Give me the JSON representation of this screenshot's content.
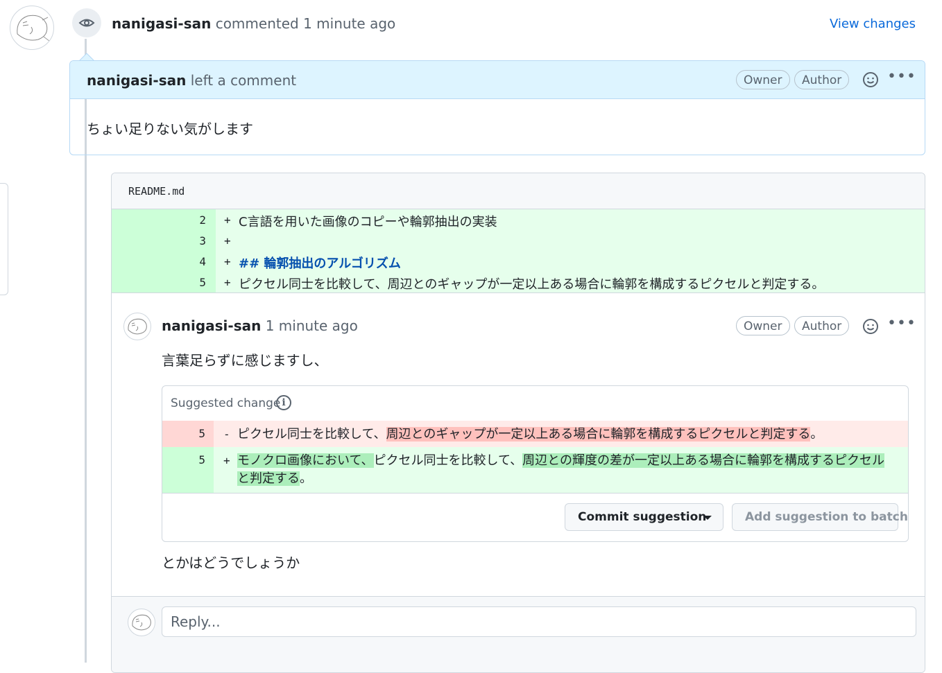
{
  "timeline": {
    "user": "nanigasi-san",
    "action": "commented",
    "time": "1 minute ago",
    "view_changes": "View changes"
  },
  "review": {
    "user": "nanigasi-san",
    "action": "left a comment",
    "badges": [
      "Owner",
      "Author"
    ],
    "body": "ちょい足りない気がします"
  },
  "file": {
    "name": "README.md",
    "lines": [
      {
        "num": "2",
        "sign": "+",
        "text": "C言語を用いた画像のコピーや輪郭抽出の実装"
      },
      {
        "num": "3",
        "sign": "+",
        "text": ""
      },
      {
        "num": "4",
        "sign": "+",
        "text": "## 輪郭抽出のアルゴリズム"
      },
      {
        "num": "5",
        "sign": "+",
        "text": "ピクセル同士を比較して、周辺とのギャップが一定以上ある場合に輪郭を構成するピクセルと判定する。"
      }
    ]
  },
  "comment": {
    "user": "nanigasi-san",
    "time": "1 minute ago",
    "badges": [
      "Owner",
      "Author"
    ],
    "body_before": "言葉足らずに感じますし、",
    "body_after": "とかはどうでしょうか",
    "suggestion": {
      "title": "Suggested change",
      "info_icon": "i",
      "del": {
        "num": "5",
        "sign": "-",
        "plain1": "ピクセル同士を比較して、",
        "hl1": "周辺とのギャップが一定以上ある場合に輪郭を構成するピクセルと判定する",
        "plain2": "。"
      },
      "add": {
        "num": "5",
        "sign": "+",
        "hl1": "モノクロ画像において、",
        "plain1": "ピクセル同士を比較して、",
        "hl2": "周辺との輝度の差が一定以上ある場合に輪郭を構成するピクセル",
        "hl3": "と判定する",
        "plain2": "。"
      },
      "commit_button": "Commit suggestion",
      "batch_button": "Add suggestion to batch"
    }
  },
  "reply": {
    "placeholder": "Reply..."
  },
  "colors": {
    "link": "#0969da",
    "added_bg": "#e6ffec",
    "deleted_bg": "#ffebe9",
    "review_header_bg": "#ddf4ff"
  }
}
